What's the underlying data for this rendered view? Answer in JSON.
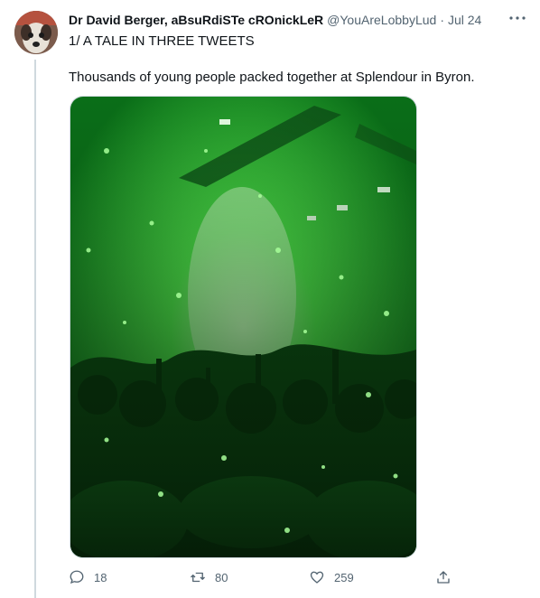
{
  "tweet": {
    "display_name": "Dr David Berger, aBsuRdiSTe cROnickLeR",
    "handle": "@YouAreLobbyLud",
    "separator": "·",
    "date": "Jul 24",
    "more_icon": "more-horizontal-icon",
    "text_line_1": "1/ A TALE IN THREE TWEETS",
    "text_line_2": "Thousands of young people packed together at Splendour in Byron."
  },
  "actions": {
    "reply_count": "18",
    "retweet_count": "80",
    "like_count": "259",
    "icons": [
      "reply-icon",
      "retweet-icon",
      "like-icon",
      "share-icon"
    ]
  },
  "colors": {
    "text": "#0f1419",
    "secondary": "#536471",
    "thread_line": "#cfd9de",
    "media_green": "#2bd13a"
  }
}
